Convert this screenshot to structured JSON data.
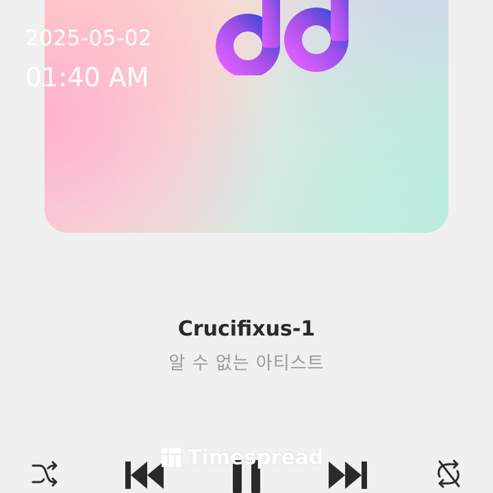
{
  "status_overlay": {
    "date": "2025-05-02",
    "time": "01:40 AM"
  },
  "album_art": {
    "icon": "music-note-icon",
    "gradient_colors": [
      "#fbd6d6",
      "#efe6de",
      "#c8ece2",
      "#d0c8f0"
    ],
    "note_colors": [
      "#e060ff",
      "#3a48d8"
    ]
  },
  "track": {
    "title": "Crucifixus-1",
    "artist": "알 수 없는 아티스트"
  },
  "controls": {
    "icons": [
      "shuffle-icon",
      "previous-icon",
      "pause-icon",
      "next-icon",
      "repeat-icon"
    ],
    "icon_color": "#2a2a2a"
  },
  "watermark": {
    "text": "Timespread"
  }
}
